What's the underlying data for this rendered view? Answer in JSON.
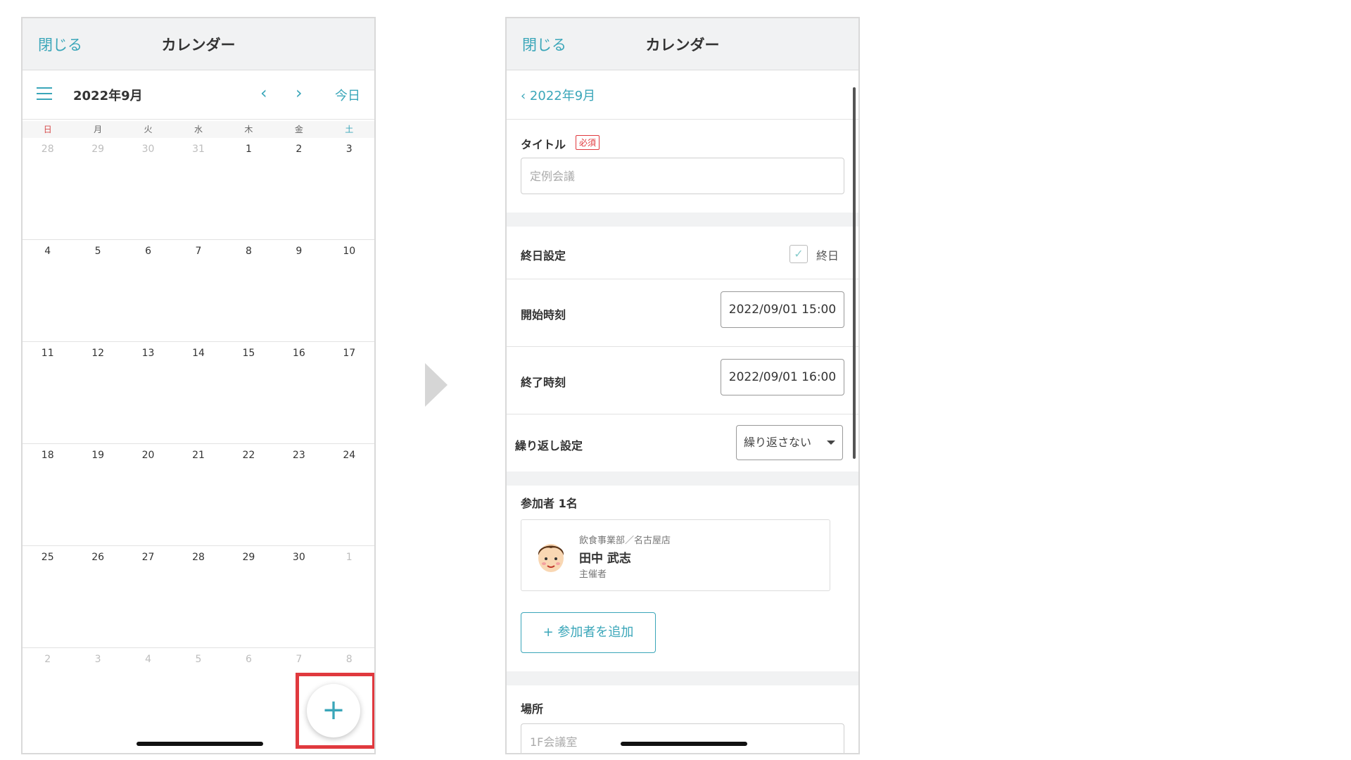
{
  "left_phone": {
    "close_label": "閉じる",
    "title": "カレンダー",
    "month": "2022年9月",
    "prev_icon": "‹",
    "next_icon": "›",
    "today_label": "今日",
    "weekdays": [
      "日",
      "月",
      "火",
      "水",
      "木",
      "金",
      "土"
    ],
    "weeks": [
      [
        "28",
        "29",
        "30",
        "31",
        "1",
        "2",
        "3"
      ],
      [
        "4",
        "5",
        "6",
        "7",
        "8",
        "9",
        "10"
      ],
      [
        "11",
        "12",
        "13",
        "14",
        "15",
        "16",
        "17"
      ],
      [
        "18",
        "19",
        "20",
        "21",
        "22",
        "23",
        "24"
      ],
      [
        "25",
        "26",
        "27",
        "28",
        "29",
        "30",
        "1"
      ],
      [
        "2",
        "3",
        "4",
        "5",
        "6",
        "7",
        "8"
      ]
    ],
    "fab_label": "+"
  },
  "right_phone": {
    "close_label": "閉じる",
    "title": "カレンダー",
    "back_label": "‹ 2022年9月",
    "title_label": "タイトル",
    "required_badge": "必須",
    "title_placeholder": "定例会議",
    "allday_label": "終日設定",
    "allday_checkbox_text": "終日",
    "allday_checked": false,
    "start_label": "開始時刻",
    "start_value": "2022/09/01 15:00",
    "end_label": "終了時刻",
    "end_value": "2022/09/01 16:00",
    "repeat_label": "繰り返し設定",
    "repeat_value": "繰り返さない",
    "participants_label": "参加者 1名",
    "participant": {
      "dept": "飲食事業部／名古屋店",
      "name": "田中 武志",
      "role": "主催者"
    },
    "add_participant_label": "+ 参加者を追加",
    "place_label": "場所",
    "place_placeholder": "1F会議室"
  },
  "colors": {
    "accent": "#3aa6b9",
    "highlight": "#e0393e",
    "sunday": "#d64a4a"
  }
}
